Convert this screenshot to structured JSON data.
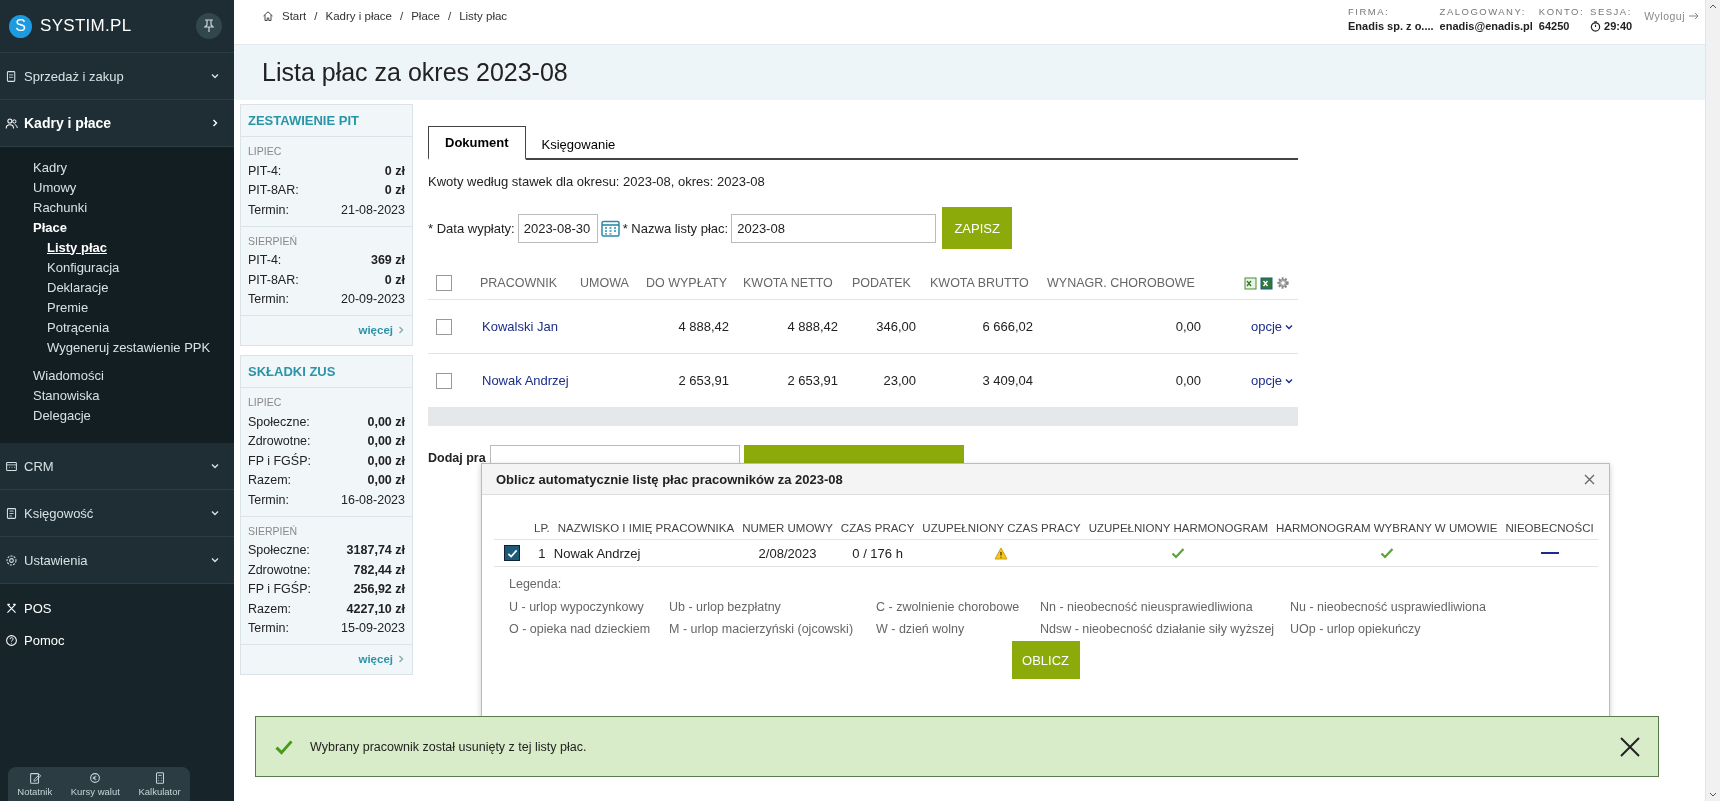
{
  "sidebar": {
    "logo_letter": "S",
    "logo_text": "SYSTIM.PL",
    "sections": [
      {
        "label": "Sprzedaż i zakup",
        "kind": "group",
        "expanded": false
      },
      {
        "label": "Kadry i płace",
        "kind": "group",
        "expanded": true,
        "children": [
          {
            "label": "Kadry",
            "selected": false
          },
          {
            "label": "Umowy",
            "selected": false
          },
          {
            "label": "Rachunki",
            "selected": false
          },
          {
            "label": "Płace",
            "selected": false,
            "children": [
              {
                "label": "Listy płac",
                "selected": true
              },
              {
                "label": "Konfiguracja",
                "selected": false
              },
              {
                "label": "Deklaracje",
                "selected": false
              },
              {
                "label": "Premie",
                "selected": false
              },
              {
                "label": "Potrącenia",
                "selected": false
              },
              {
                "label": "Wygeneruj zestawienie PPK",
                "selected": false
              }
            ]
          },
          {
            "label": "Wiadomości",
            "selected": false
          },
          {
            "label": "Stanowiska",
            "selected": false
          },
          {
            "label": "Delegacje",
            "selected": false
          }
        ]
      },
      {
        "label": "CRM",
        "kind": "group",
        "expanded": false
      },
      {
        "label": "Księgowość",
        "kind": "group",
        "expanded": false
      },
      {
        "label": "Ustawienia",
        "kind": "group",
        "expanded": false
      },
      {
        "label": "POS",
        "kind": "link"
      },
      {
        "label": "Pomoc",
        "kind": "link"
      }
    ],
    "tools": [
      "Notatnik",
      "Kursy walut",
      "Kalkulator"
    ]
  },
  "breadcrumb": {
    "separator": "/",
    "items": [
      "Start",
      "Kadry i płace",
      "Płace",
      "Listy płac"
    ]
  },
  "session": {
    "fields": [
      {
        "label": "FIRMA:",
        "value": "Enadis sp. z o...."
      },
      {
        "label": "ZALOGOWANY:",
        "value": "enadis@enadis.pl"
      },
      {
        "label": "KONTO:",
        "value": "64250"
      },
      {
        "label": "SESJA:",
        "value": "29:40"
      }
    ],
    "logout": "Wyloguj"
  },
  "page_title": "Lista płac za okres 2023-08",
  "summary_cards": [
    {
      "title": "ZESTAWIENIE PIT",
      "more": "więcej",
      "groups": [
        {
          "month": "LIPIEC",
          "rows": [
            {
              "label": "PIT-4:",
              "value": "0 zł",
              "emphasis": true
            },
            {
              "label": "PIT-8AR:",
              "value": "0 zł",
              "emphasis": true
            },
            {
              "label": "Termin:",
              "value": "21-08-2023",
              "emphasis": false
            }
          ]
        },
        {
          "month": "SIERPIEŃ",
          "rows": [
            {
              "label": "PIT-4:",
              "value": "369 zł",
              "emphasis": true
            },
            {
              "label": "PIT-8AR:",
              "value": "0 zł",
              "emphasis": true
            },
            {
              "label": "Termin:",
              "value": "20-09-2023",
              "emphasis": false
            }
          ]
        }
      ]
    },
    {
      "title": "SKŁADKI ZUS",
      "more": "więcej",
      "groups": [
        {
          "month": "LIPIEC",
          "rows": [
            {
              "label": "Społeczne:",
              "value": "0,00 zł",
              "emphasis": true
            },
            {
              "label": "Zdrowotne:",
              "value": "0,00 zł",
              "emphasis": true
            },
            {
              "label": "FP i FGŚP:",
              "value": "0,00 zł",
              "emphasis": true
            },
            {
              "label": "Razem:",
              "value": "0,00 zł",
              "emphasis": true
            },
            {
              "label": "Termin:",
              "value": "16-08-2023",
              "emphasis": false
            }
          ]
        },
        {
          "month": "SIERPIEŃ",
          "rows": [
            {
              "label": "Społeczne:",
              "value": "3187,74 zł",
              "emphasis": true
            },
            {
              "label": "Zdrowotne:",
              "value": "782,44 zł",
              "emphasis": true
            },
            {
              "label": "FP i FGŚP:",
              "value": "256,92 zł",
              "emphasis": true
            },
            {
              "label": "Razem:",
              "value": "4227,10 zł",
              "emphasis": true
            },
            {
              "label": "Termin:",
              "value": "15-09-2023",
              "emphasis": false
            }
          ]
        }
      ]
    }
  ],
  "tabs": [
    {
      "label": "Dokument",
      "selected": true
    },
    {
      "label": "Księgowanie",
      "selected": false
    }
  ],
  "rates_note": "Kwoty według stawek dla okresu: 2023-08, okres: 2023-08",
  "form": {
    "date_label": "* Data wypłaty:",
    "date_value": "2023-08-30",
    "name_label": "* Nazwa listy płac:",
    "name_value": "2023-08",
    "save": "ZAPISZ"
  },
  "table": {
    "all_checked": false,
    "columns": [
      "PRACOWNIK",
      "UMOWA",
      "DO WYPŁATY",
      "KWOTA NETTO",
      "PODATEK",
      "KWOTA BRUTTO",
      "WYNAGR. CHOROBOWE"
    ],
    "rows": [
      {
        "checked": false,
        "employee": "Kowalski Jan",
        "to_pay": "4 888,42",
        "net": "4 888,42",
        "tax": "346,00",
        "gross": "6 666,02",
        "sick_pay": "0,00",
        "options": "opcje"
      },
      {
        "checked": false,
        "employee": "Nowak Andrzej",
        "to_pay": "2 653,91",
        "net": "2 653,91",
        "tax": "23,00",
        "gross": "3 409,04",
        "sick_pay": "0,00",
        "options": "opcje"
      }
    ]
  },
  "add_employee": {
    "label": "Dodaj pra"
  },
  "dialog": {
    "title": "Oblicz automatycznie listę płac pracowników za 2023-08",
    "columns": [
      "LP.",
      "NAZWISKO I IMIĘ PRACOWNIKA",
      "NUMER UMOWY",
      "CZAS PRACY",
      "UZUPEŁNIONY CZAS PRACY",
      "UZUPEŁNIONY HARMONOGRAM",
      "HARMONOGRAM WYBRANY W UMOWIE",
      "NIEOBECNOŚCI"
    ],
    "rows": [
      {
        "checked": true,
        "lp": "1",
        "name": "Nowak Andrzej",
        "contract": "2/08/2023",
        "hours": "0 / 176 h",
        "statuses": [
          {
            "kind": "warning"
          },
          {
            "kind": "ok"
          },
          {
            "kind": "ok"
          },
          {
            "kind": "none"
          }
        ]
      }
    ],
    "legend_title": "Legenda:",
    "legend": [
      "U - urlop wypoczynkowy",
      "Ub - urlop bezpłatny",
      "C - zwolnienie chorobowe",
      "Nn - nieobecność nieusprawiedliwiona",
      "Nu - nieobecność usprawiedliwiona",
      "O - opieka nad dzieckiem",
      "M - urlop macierzyński (ojcowski)",
      "W - dzień wolny",
      "Ndsw - nieobecność działanie siły wyższej",
      "UOp - urlop opiekuńczy"
    ],
    "button": "OBLICZ"
  },
  "toast": {
    "kind": "success",
    "message": "Wybrany pracownik został usunięty z tej listy płac."
  }
}
